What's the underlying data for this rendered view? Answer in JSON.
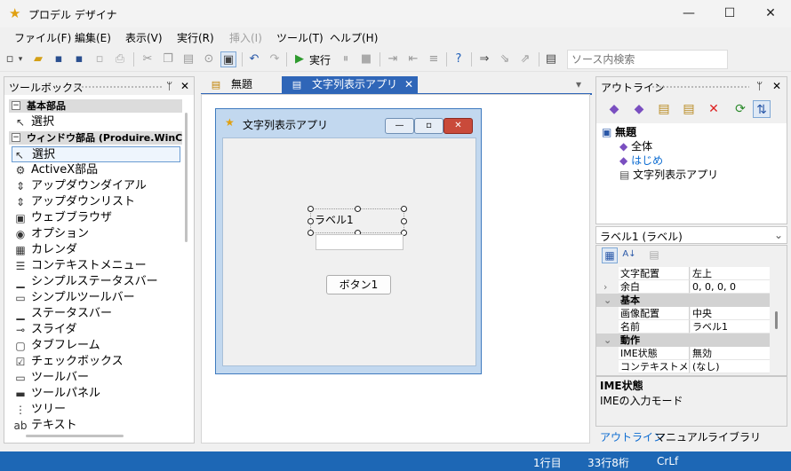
{
  "app": {
    "title": "プロデル デザイナ"
  },
  "window_controls": {
    "minimize": "—",
    "maximize": "☐",
    "close": "✕"
  },
  "menu": [
    {
      "label": "ファイル(F)",
      "enabled": true
    },
    {
      "label": "編集(E)",
      "enabled": true
    },
    {
      "label": "表示(V)",
      "enabled": true
    },
    {
      "label": "実行(R)",
      "enabled": true
    },
    {
      "label": "挿入(I)",
      "enabled": false
    },
    {
      "label": "ツール(T)",
      "enabled": true
    },
    {
      "label": "ヘルプ(H)",
      "enabled": true
    }
  ],
  "toolbar": {
    "run_label": "実行",
    "search_placeholder": "ソース内検索",
    "icons": [
      "new-file-icon",
      "open-folder-icon",
      "save-icon",
      "save-all-icon",
      "copy-doc-icon",
      "print-icon",
      "cut-icon",
      "copy-icon",
      "paste-icon",
      "find-icon",
      "designer-icon",
      "undo-icon",
      "redo-icon",
      "run-icon",
      "pause-icon",
      "stop-icon",
      "indent-icon",
      "outdent-icon",
      "comment-icon",
      "help-icon",
      "step-icon",
      "step-over-icon",
      "step-out-icon",
      "clipboard-icon"
    ]
  },
  "toolbox": {
    "title": "ツールボックス",
    "pin": "ᛘ",
    "close": "✕",
    "group1": {
      "toggle": "−",
      "label": "基本部品"
    },
    "group1_items": [
      {
        "label": "選択",
        "icon": "pointer-icon",
        "glyph": "↖"
      }
    ],
    "group2": {
      "toggle": "−",
      "label": "ウィンドウ部品 (Produire.WinControls)"
    },
    "group2_items": [
      {
        "label": "選択",
        "icon": "pointer-icon",
        "glyph": "↖"
      },
      {
        "label": "ActiveX部品",
        "icon": "gear-icon",
        "glyph": "⚙"
      },
      {
        "label": "アップダウンダイアル",
        "icon": "updown-icon",
        "glyph": "⇕"
      },
      {
        "label": "アップダウンリスト",
        "icon": "updown-list-icon",
        "glyph": "⇕"
      },
      {
        "label": "ウェブブラウザ",
        "icon": "browser-icon",
        "glyph": "▣"
      },
      {
        "label": "オプション",
        "icon": "radio-icon",
        "glyph": "◉"
      },
      {
        "label": "カレンダ",
        "icon": "calendar-icon",
        "glyph": "▦"
      },
      {
        "label": "コンテキストメニュー",
        "icon": "context-menu-icon",
        "glyph": "☰"
      },
      {
        "label": "シンプルステータスバー",
        "icon": "statusbar-icon",
        "glyph": "▁"
      },
      {
        "label": "シンプルツールバー",
        "icon": "toolbar-icon",
        "glyph": "▭"
      },
      {
        "label": "ステータスバー",
        "icon": "statusbar-icon",
        "glyph": "▁"
      },
      {
        "label": "スライダ",
        "icon": "slider-icon",
        "glyph": "⊸"
      },
      {
        "label": "タブフレーム",
        "icon": "tab-frame-icon",
        "glyph": "▢"
      },
      {
        "label": "チェックボックス",
        "icon": "checkbox-icon",
        "glyph": "☑"
      },
      {
        "label": "ツールバー",
        "icon": "toolbar-icon",
        "glyph": "▭"
      },
      {
        "label": "ツールパネル",
        "icon": "tool-panel-icon",
        "glyph": "▬"
      },
      {
        "label": "ツリー",
        "icon": "tree-icon",
        "glyph": "⋮"
      },
      {
        "label": "テキスト",
        "icon": "text-icon",
        "glyph": "ab"
      }
    ]
  },
  "tabs": [
    {
      "label": "無題",
      "icon": "document-icon",
      "active": false
    },
    {
      "label": "文字列表示アプリ",
      "icon": "form-icon",
      "active": true,
      "close": "✕"
    }
  ],
  "tab_overflow": "▾",
  "form": {
    "title": "文字列表示アプリ",
    "label_text": "ラベル1",
    "button_text": "ボタン1",
    "controls": {
      "minimize": "—",
      "maximize": "▫",
      "close": "✕"
    }
  },
  "outline": {
    "title": "アウトライン",
    "pin": "ᛘ",
    "close": "✕",
    "root": "無題",
    "children": [
      "全体",
      "はじめ",
      "文字列表示アプリ"
    ]
  },
  "properties": {
    "selected": "ラベル1 (ラベル)",
    "rows": [
      {
        "type": "prop",
        "key": "文字配置",
        "value": "左上"
      },
      {
        "type": "prop",
        "key": "余白",
        "value": "0, 0, 0, 0",
        "expand": "›"
      },
      {
        "type": "cat",
        "key": "基本",
        "toggle": "⌄"
      },
      {
        "type": "prop",
        "key": "画像配置",
        "value": "中央"
      },
      {
        "type": "prop",
        "key": "名前",
        "value": "ラベル1"
      },
      {
        "type": "cat",
        "key": "動作",
        "toggle": "⌄"
      },
      {
        "type": "prop",
        "key": "IME状態",
        "value": "無効"
      },
      {
        "type": "prop",
        "key": "コンテキストメニュー",
        "value": "(なし)"
      }
    ],
    "desc_title": "IME状態",
    "desc_text": "IMEの入力モード"
  },
  "bottom_tabs": [
    {
      "label": "アウトライン",
      "active": true
    },
    {
      "label": "マニュアル",
      "active": false
    },
    {
      "label": "ライブラリ",
      "active": false
    }
  ],
  "status": {
    "line": "1行目",
    "position": "33行8桁",
    "eol": "CrLf"
  },
  "colors": {
    "accent": "#2f66b8",
    "status": "#1d67b5",
    "link": "#0b6bd1"
  }
}
